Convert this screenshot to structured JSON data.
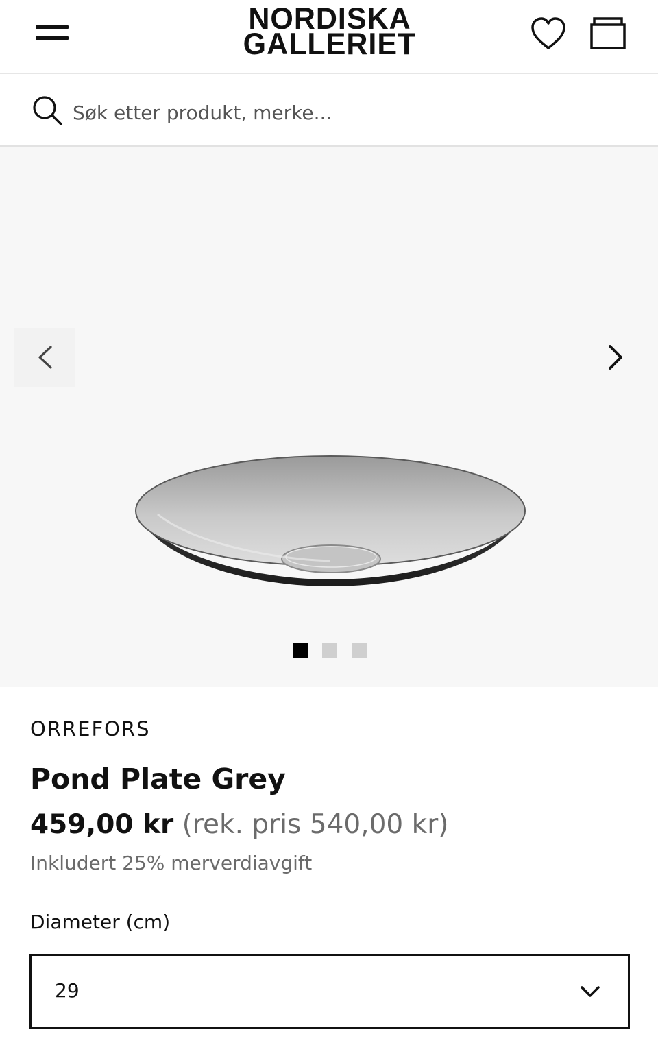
{
  "header": {
    "menu_label": "Meny",
    "logo_line1": "NORDISKA",
    "logo_line2": "GALLERIET",
    "wishlist_icon": "heart-icon",
    "cart_icon": "bag-icon"
  },
  "search": {
    "placeholder": "Søk etter produkt, merke...",
    "value": "",
    "icon": "search-icon"
  },
  "gallery": {
    "prev_icon": "chevron-left-icon",
    "next_icon": "chevron-right-icon",
    "image_subject": "grey-glass-plate",
    "image_count": 3,
    "active_index": 0
  },
  "product": {
    "brand": "ORREFORS",
    "title": "Pond Plate Grey",
    "price": "459,00 kr",
    "rrp": "(rek. pris 540,00 kr)",
    "vat_note": "Inkludert 25% merverdiavgift"
  },
  "options": {
    "label": "Diameter (cm)",
    "selected": "29"
  },
  "colors": {
    "text": "#111111",
    "muted": "#6b6b6b",
    "gallery_bg": "#f7f7f7",
    "dot_active": "#000000",
    "dot_inactive": "#cfcfcf"
  }
}
